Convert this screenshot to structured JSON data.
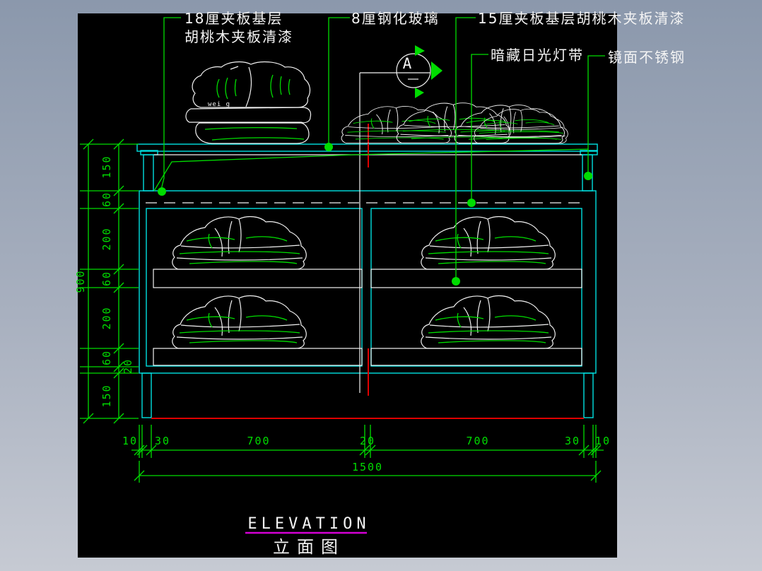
{
  "drawing": {
    "callouts": {
      "plywood18_line1": "18厘夹板基层",
      "plywood18_line2": "胡桃木夹板清漆",
      "glass": "8厘钢化玻璃",
      "plywood15": "15厘夹板基层胡桃木夹板清漆",
      "hidden_light": "暗藏日光灯带",
      "mirror_steel": "镜面不锈钢"
    },
    "section_marker": {
      "label": "A"
    },
    "clothing_mark": "wei g",
    "dimensions": {
      "vertical": {
        "overall": "900",
        "chain": [
          "150",
          "60",
          "200",
          "60",
          "200",
          "60",
          "20",
          "150"
        ]
      },
      "horizontal": {
        "overall": "1500",
        "chain": [
          "10",
          "30",
          "700",
          "20",
          "700",
          "30",
          "10"
        ]
      }
    },
    "title": {
      "en": "ELEVATION",
      "zh": "立面图"
    },
    "colors": {
      "surround": "#9aa5b5",
      "canvas": "#000000",
      "dimension_green": "#00dd00",
      "structure_cyan": "#00e0e0",
      "linework_white": "#f2f2f2",
      "centerline_red": "#e00000",
      "underline_magenta": "#d400d4"
    }
  }
}
